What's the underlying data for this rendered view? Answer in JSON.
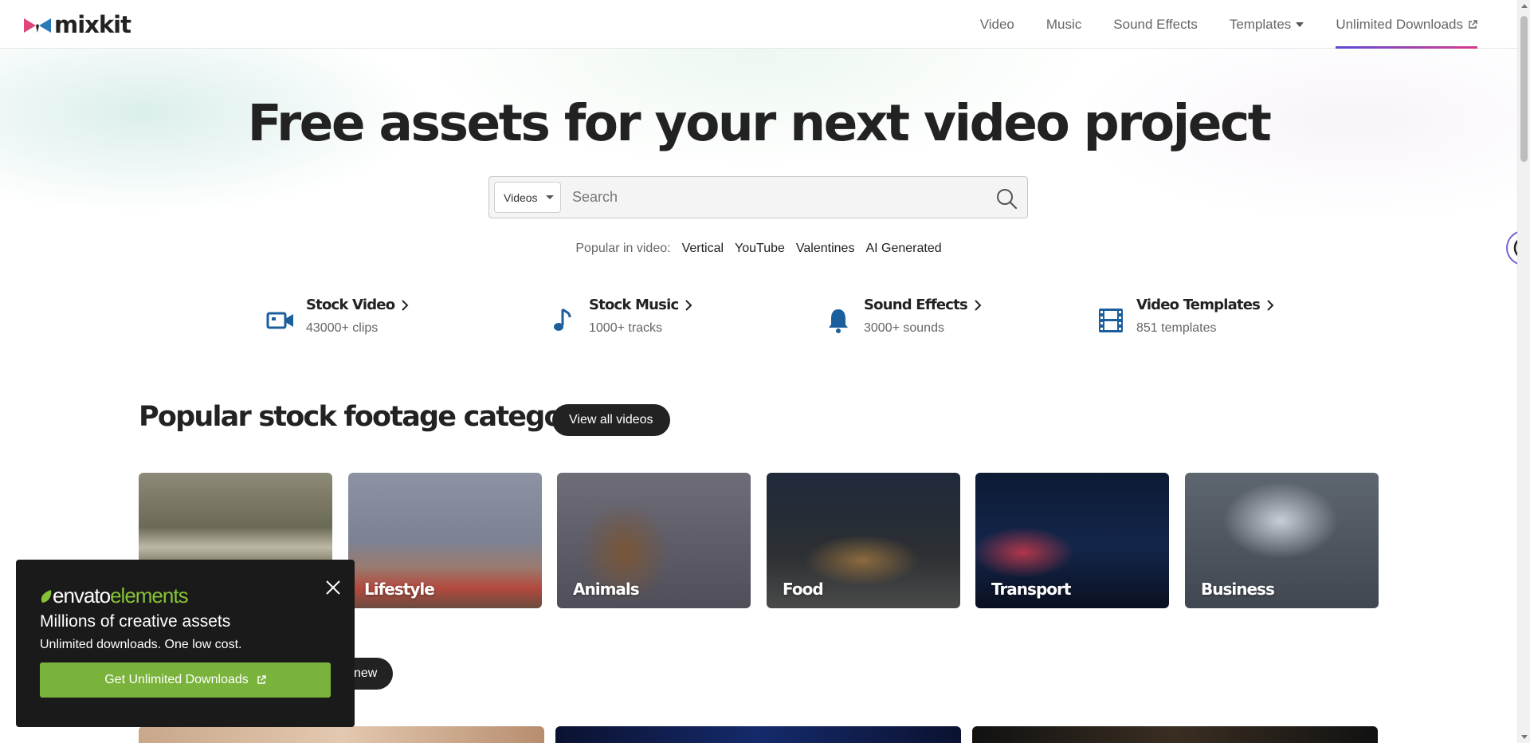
{
  "header": {
    "logo_text": "mixkit",
    "nav": [
      {
        "label": "Video"
      },
      {
        "label": "Music"
      },
      {
        "label": "Sound Effects"
      },
      {
        "label": "Templates"
      },
      {
        "label": "Unlimited Downloads"
      }
    ]
  },
  "hero": {
    "title": "Free assets for your next video project",
    "search": {
      "type_selected": "Videos",
      "placeholder": "Search",
      "value": ""
    },
    "popular": {
      "lead": "Popular in video:",
      "tags": [
        "Vertical",
        "YouTube",
        "Valentines",
        "AI Generated"
      ]
    }
  },
  "categories": [
    {
      "title": "Stock Video",
      "sub": "43000+ clips",
      "icon": "video-camera-icon"
    },
    {
      "title": "Stock Music",
      "sub": "1000+ tracks",
      "icon": "music-note-icon"
    },
    {
      "title": "Sound Effects",
      "sub": "3000+ sounds",
      "icon": "bell-icon"
    },
    {
      "title": "Video Templates",
      "sub": "851 templates",
      "icon": "film-icon"
    }
  ],
  "section": {
    "title": "Popular stock footage categories",
    "button": "View all videos",
    "second_button_partial": "new",
    "tiles": [
      {
        "label": ""
      },
      {
        "label": "Lifestyle"
      },
      {
        "label": "Animals"
      },
      {
        "label": "Food"
      },
      {
        "label": "Transport"
      },
      {
        "label": "Business"
      }
    ]
  },
  "promo": {
    "logo_part1": "envato",
    "logo_part2": "elements",
    "title": "Millions of creative assets",
    "subtitle": "Unlimited downloads. One low cost.",
    "button": "Get Unlimited Downloads"
  },
  "colors": {
    "accent_green": "#7ab33b",
    "brand_blue": "#1b5e9c",
    "dark": "#222222"
  }
}
